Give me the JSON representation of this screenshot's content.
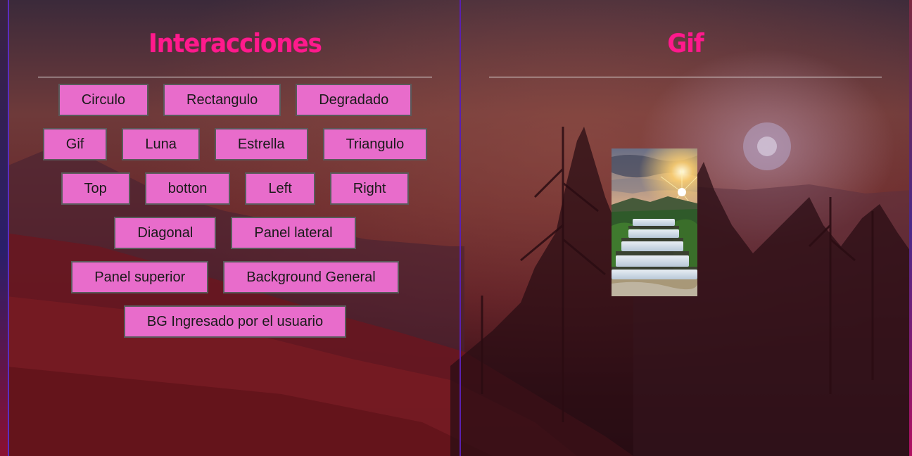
{
  "left_panel": {
    "title": "Interacciones",
    "rows": [
      [
        "Circulo",
        "Rectangulo",
        "Degradado"
      ],
      [
        "Gif",
        "Luna",
        "Estrella",
        "Triangulo"
      ],
      [
        "Top",
        "botton",
        "Left",
        "Right"
      ],
      [
        "Diagonal",
        "Panel lateral"
      ],
      [
        "Panel superior",
        "Background General"
      ],
      [
        "BG Ingresado por el usuario"
      ]
    ]
  },
  "right_panel": {
    "title": "Gif"
  },
  "colors": {
    "title": "#ff1a8c",
    "button_bg": "#e86ccb",
    "button_border": "#5a5a5a",
    "divider": "#5a20b0"
  },
  "icons": {
    "gif_image": "waterfall-sunset-gif"
  }
}
